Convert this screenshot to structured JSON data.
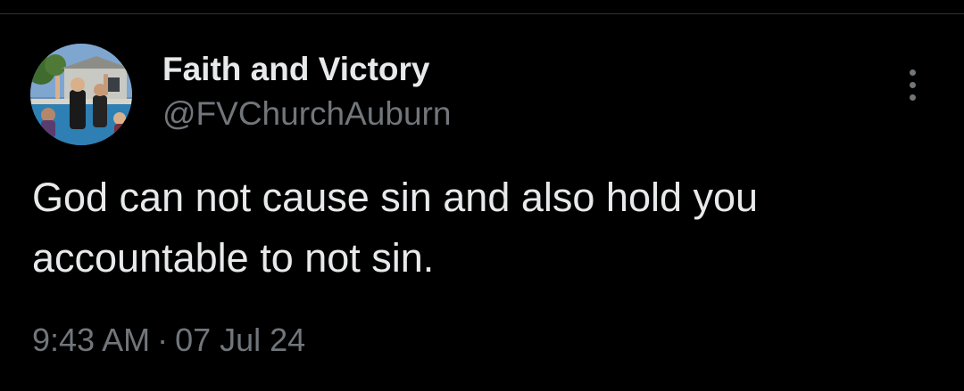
{
  "tweet": {
    "author": {
      "display_name": "Faith and Victory",
      "handle": "@FVChurchAuburn",
      "avatar_icon": "profile-photo-baptism"
    },
    "text": "God can not cause sin and also hold you accountable to not sin.",
    "time": "9:43 AM",
    "separator": "·",
    "date": "07 Jul 24",
    "more_icon": "more-vertical-icon"
  },
  "colors": {
    "background": "#000000",
    "primary_text": "#e7e9ea",
    "secondary_text": "#71767b",
    "divider": "#2f3336"
  }
}
